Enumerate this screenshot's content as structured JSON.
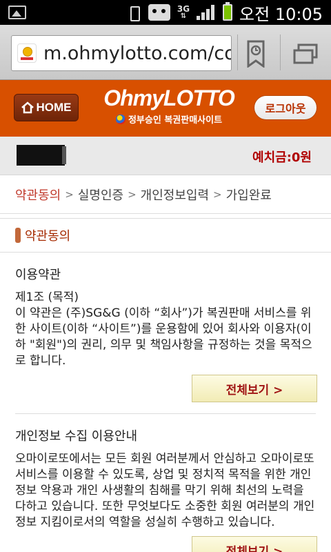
{
  "status_bar": {
    "network": "3G",
    "time": "오전 10:05",
    "icons": [
      "gallery-icon",
      "vibrate-icon",
      "android-icon",
      "signal-icon",
      "battery-icon"
    ]
  },
  "browser": {
    "url": "m.ohmylotto.com/con",
    "icons": [
      "bookmark-icon",
      "tabs-icon"
    ]
  },
  "header": {
    "home_label": "HOME",
    "logo_oh": "OhmyLOTTO",
    "logo_sub": "정부승인 복권판매사이트",
    "logout_label": "로그아웃",
    "brand_color": "#d85000"
  },
  "user": {
    "deposit": "예치금:0원"
  },
  "steps": {
    "items": [
      "약관동의",
      "실명인증",
      "개인정보입력",
      "가입완료"
    ],
    "separator": ">"
  },
  "section": {
    "title": "약관동의"
  },
  "terms": {
    "title": "이용약관",
    "text": "제1조 (목적)\n이 약관은 (주)SG&G (이하 “회사”)가 복권판매 서비스를 위한 사이트(이하 “사이트”)를 운용함에 있어 회사와 이용자(이하 \"회원\")의 권리, 의무 및 책임사항을 규정하는 것을 목적으로 합니다.",
    "button": "전체보기 >"
  },
  "privacy": {
    "title": "개인정보 수집 이용안내",
    "text": "오마이로또에서는 모든 회원 여러분께서 안심하고 오마이로또 서비스를 이용할 수 있도록, 상업 및 정치적 목적을 위한 개인정보 악용과 개인 사생활의 침해를 막기 위해 최선의 노력을 다하고 있습니다. 또한 무엇보다도 소중한 회원 여러분의 개인정보 지킴이로서의 역할을 성실히 수행하고 있습니다.",
    "button": "전체보기 >"
  }
}
